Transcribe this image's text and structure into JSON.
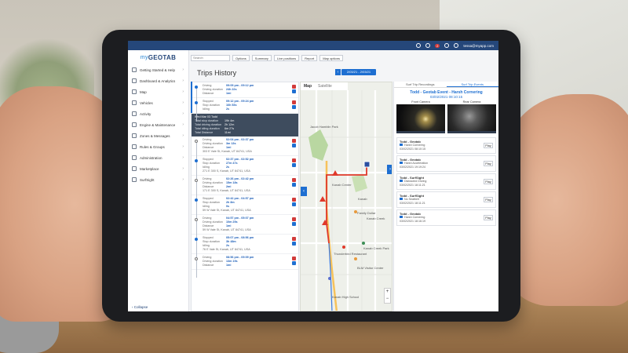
{
  "topbar": {
    "notif_count": "2",
    "user": "tessa@myapp.com"
  },
  "logo": {
    "brand": "my",
    "product": "GEOTAB"
  },
  "sidebar": {
    "items": [
      {
        "label": "Getting Started & Help",
        "icon": "help-icon"
      },
      {
        "label": "Dashboard & Analytics",
        "icon": "dashboard-icon"
      },
      {
        "label": "Map",
        "icon": "map-icon"
      },
      {
        "label": "Vehicles",
        "icon": "vehicle-icon"
      },
      {
        "label": "Activity",
        "icon": "activity-icon"
      },
      {
        "label": "Engine & Maintenance",
        "icon": "engine-icon"
      },
      {
        "label": "Zones & Messages",
        "icon": "zones-icon"
      },
      {
        "label": "Rules & Groups",
        "icon": "rules-icon"
      },
      {
        "label": "Administration",
        "icon": "admin-icon"
      },
      {
        "label": "Marketplace",
        "icon": "marketplace-icon"
      },
      {
        "label": "SurfSight",
        "icon": "surfsight-icon"
      }
    ],
    "collapse": "Collapse"
  },
  "toolbar": {
    "search_placeholder": "Search",
    "options": "Options",
    "summary": "Summary",
    "live_positions": "Live positions",
    "report": "Report",
    "add_zone": "Add zone",
    "map_options": "Map options"
  },
  "page": {
    "title": "Trips History",
    "date_range": "2/03/21 - 2/03/21"
  },
  "trips": [
    {
      "rows": [
        [
          "Driving",
          "09:09 pm - 09:12 pm"
        ],
        [
          "Driving duration",
          "24h 22s"
        ],
        [
          "Distance",
          "1mi"
        ]
      ],
      "dot": "filled"
    },
    {
      "rows": [
        [
          "Stopped",
          "09:12 pm - 09:24 pm"
        ],
        [
          "Stop duration",
          "16h 53s"
        ],
        [
          "Idling",
          "2s"
        ]
      ],
      "dot": "filled"
    },
    {
      "summary": true,
      "title": "Wed Mar 03  Todd",
      "rows": [
        [
          "Total stop duration",
          "19h 4m"
        ],
        [
          "Total driving duration",
          "2h 12m"
        ],
        [
          "Total idling duration",
          "6m 27s"
        ],
        [
          "Total Distance",
          "11mi"
        ]
      ]
    },
    {
      "rows": [
        [
          "Driving",
          "02:04 pm - 02:37 pm"
        ],
        [
          "Driving duration",
          "3m 13s"
        ],
        [
          "Distance",
          "1mi"
        ]
      ],
      "addr": "303 E Vale St, Kanab, UT 84741, USA",
      "dot": "empty"
    },
    {
      "rows": [
        [
          "Stopped",
          "02:37 pm - 02:52 pm"
        ],
        [
          "Stop duration",
          "27m 47s"
        ],
        [
          "Idling",
          "2s"
        ]
      ],
      "addr": "271 E 300 S, Kanab, UT 84741, USA",
      "dot": "filled"
    },
    {
      "rows": [
        [
          "Driving",
          "02:26 pm - 02:42 pm"
        ],
        [
          "Driving duration",
          "15m 18s"
        ],
        [
          "Distance",
          "2mi"
        ]
      ],
      "addr": "171 E 300 S, Kanab, UT 84741, USA",
      "dot": "empty"
    },
    {
      "rows": [
        [
          "Stopped",
          "02:42 pm - 04:57 pm"
        ],
        [
          "Stop duration",
          "2h 8m"
        ],
        [
          "Idling",
          "0s"
        ]
      ],
      "addr": "59 W Vale St, Kanab, UT 84741, USA",
      "dot": "filled"
    },
    {
      "rows": [
        [
          "Driving",
          "04:57 pm - 05:07 pm"
        ],
        [
          "Driving duration",
          "10m 25s"
        ],
        [
          "Distance",
          "1mi"
        ]
      ],
      "addr": "59 W Vale St, Kanab, UT 84741, USA",
      "dot": "empty"
    },
    {
      "rows": [
        [
          "Stopped",
          "05:07 pm - 08:56 pm"
        ],
        [
          "Stop duration",
          "3h 48m"
        ],
        [
          "Idling",
          "2s"
        ]
      ],
      "addr": "76 E Vale St, Kanab, UT 84741, USA",
      "dot": "filled"
    },
    {
      "rows": [
        [
          "Driving",
          "08:56 pm - 09:09 pm"
        ],
        [
          "Driving duration",
          "13m 19s"
        ],
        [
          "Distance",
          "1mi"
        ]
      ],
      "dot": "empty"
    }
  ],
  "map": {
    "tab_map": "Map",
    "tab_satellite": "Satellite",
    "zoom_in": "+",
    "zoom_out": "−",
    "labels": [
      "Jacob Hamblin Park",
      "Kanab Center",
      "Kanab",
      "Kanab Creek",
      "Kanab High School",
      "Kanab Creek Park",
      "Family Dollar",
      "Thunderbird Restaurant",
      "BLM Visitor Center"
    ]
  },
  "right": {
    "tab_recordings": "Surf Trip Recordings",
    "tab_events": "Surf Trip Events",
    "event_title": "Todd - Geotab Event - Harsh Cornering",
    "event_time": "03/02/2021 08:10:15",
    "front_camera": "Front Camera",
    "rear_camera": "Rear Camera",
    "events": [
      {
        "name": "Todd - Geotab",
        "type": "Harsh Cornering",
        "time": "03/02/2021 08:10:15",
        "play": "Play"
      },
      {
        "name": "Todd - Geotab",
        "type": "Harsh Acceleration",
        "time": "03/02/2021 19:19:24",
        "play": "Play"
      },
      {
        "name": "Todd - SurfSight",
        "type": "Distracted Driving",
        "time": "03/02/2021 18:11:21",
        "play": "Play"
      },
      {
        "name": "Todd - SurfSight",
        "type": "No Seatbelt",
        "time": "03/02/2021 18:11:21",
        "play": "Play"
      },
      {
        "name": "Todd - Geotab",
        "type": "Harsh Cornering",
        "time": "03/02/2021 18:16:19",
        "play": "Play"
      }
    ]
  },
  "colors": {
    "primary": "#1e6fd1",
    "topbar": "#25477a",
    "route": "#e0392b",
    "alert": "#d23b3b"
  }
}
